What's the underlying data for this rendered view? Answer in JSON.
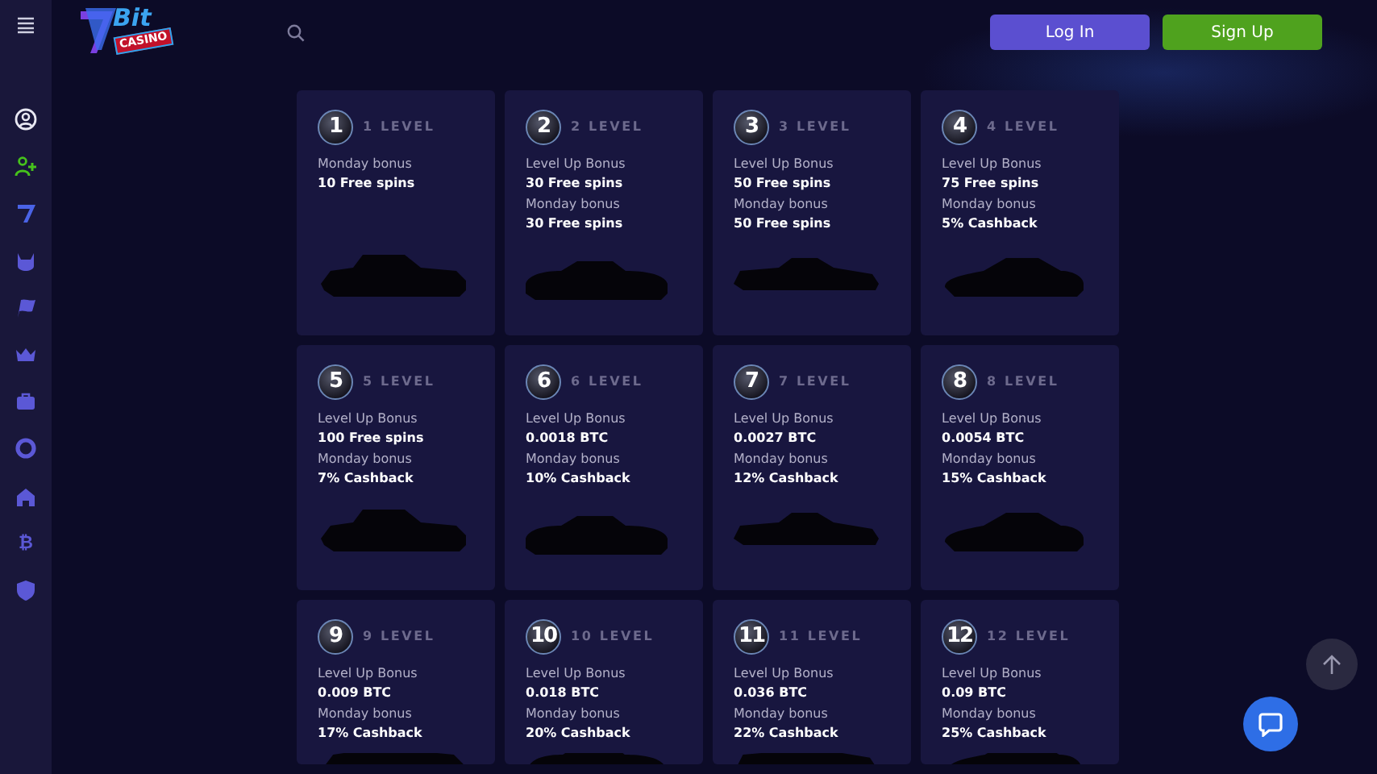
{
  "logo": {
    "word": "Bit",
    "sub": "CASINO"
  },
  "header": {
    "buttons": [
      {
        "label": "Log In",
        "kind": "login"
      },
      {
        "label": "Sign Up",
        "kind": "signup"
      }
    ]
  },
  "sidebar": {
    "items": [
      {
        "kind": "user"
      },
      {
        "kind": "user-plus"
      },
      {
        "kind": "seven"
      },
      {
        "kind": "shield-star"
      },
      {
        "kind": "flag"
      },
      {
        "kind": "crown"
      },
      {
        "kind": "briefcase"
      },
      {
        "kind": "lifebuoy"
      },
      {
        "kind": "house"
      },
      {
        "kind": "coin",
        "glyph": "₿"
      },
      {
        "kind": "shield"
      }
    ]
  },
  "levels": [
    {
      "number": "1",
      "title": "1 LEVEL",
      "lines": [
        {
          "text": "Monday bonus",
          "kind": "label"
        },
        {
          "text": "10 Free spins",
          "kind": "value"
        }
      ]
    },
    {
      "number": "2",
      "title": "2 LEVEL",
      "lines": [
        {
          "text": "Level Up Bonus",
          "kind": "label"
        },
        {
          "text": "30 Free spins",
          "kind": "value"
        },
        {
          "text": "Monday bonus",
          "kind": "label"
        },
        {
          "text": "30 Free spins",
          "kind": "value"
        }
      ]
    },
    {
      "number": "3",
      "title": "3 LEVEL",
      "lines": [
        {
          "text": "Level Up Bonus",
          "kind": "label"
        },
        {
          "text": "50 Free spins",
          "kind": "value"
        },
        {
          "text": "Monday bonus",
          "kind": "label"
        },
        {
          "text": "50 Free spins",
          "kind": "value"
        }
      ]
    },
    {
      "number": "4",
      "title": "4 LEVEL",
      "lines": [
        {
          "text": "Level Up Bonus",
          "kind": "label"
        },
        {
          "text": "75 Free spins",
          "kind": "value"
        },
        {
          "text": "Monday bonus",
          "kind": "label"
        },
        {
          "text": "5% Cashback",
          "kind": "value"
        }
      ]
    },
    {
      "number": "5",
      "title": "5 LEVEL",
      "lines": [
        {
          "text": "Level Up Bonus",
          "kind": "label"
        },
        {
          "text": "100 Free spins",
          "kind": "value"
        },
        {
          "text": "Monday bonus",
          "kind": "label"
        },
        {
          "text": "7% Cashback",
          "kind": "value"
        }
      ]
    },
    {
      "number": "6",
      "title": "6 LEVEL",
      "lines": [
        {
          "text": "Level Up Bonus",
          "kind": "label"
        },
        {
          "text": "0.0018 BTC",
          "kind": "value"
        },
        {
          "text": "Monday bonus",
          "kind": "label"
        },
        {
          "text": "10% Cashback",
          "kind": "value"
        }
      ]
    },
    {
      "number": "7",
      "title": "7 LEVEL",
      "lines": [
        {
          "text": "Level Up Bonus",
          "kind": "label"
        },
        {
          "text": "0.0027 BTC",
          "kind": "value"
        },
        {
          "text": "Monday bonus",
          "kind": "label"
        },
        {
          "text": "12% Cashback",
          "kind": "value"
        }
      ]
    },
    {
      "number": "8",
      "title": "8 LEVEL",
      "lines": [
        {
          "text": "Level Up Bonus",
          "kind": "label"
        },
        {
          "text": "0.0054 BTC",
          "kind": "value"
        },
        {
          "text": "Monday bonus",
          "kind": "label"
        },
        {
          "text": "15% Cashback",
          "kind": "value"
        }
      ]
    },
    {
      "number": "9",
      "title": "9 LEVEL",
      "lines": [
        {
          "text": "Level Up Bonus",
          "kind": "label"
        },
        {
          "text": "0.009 BTC",
          "kind": "value"
        },
        {
          "text": "Monday bonus",
          "kind": "label"
        },
        {
          "text": "17% Cashback",
          "kind": "value"
        }
      ]
    },
    {
      "number": "10",
      "title": "10 LEVEL",
      "lines": [
        {
          "text": "Level Up Bonus",
          "kind": "label"
        },
        {
          "text": "0.018 BTC",
          "kind": "value"
        },
        {
          "text": "Monday bonus",
          "kind": "label"
        },
        {
          "text": "20% Cashback",
          "kind": "value"
        }
      ]
    },
    {
      "number": "11",
      "title": "11 LEVEL",
      "lines": [
        {
          "text": "Level Up Bonus",
          "kind": "label"
        },
        {
          "text": "0.036 BTC",
          "kind": "value"
        },
        {
          "text": "Monday bonus",
          "kind": "label"
        },
        {
          "text": "22% Cashback",
          "kind": "value"
        }
      ]
    },
    {
      "number": "12",
      "title": "12 LEVEL",
      "lines": [
        {
          "text": "Level Up Bonus",
          "kind": "label"
        },
        {
          "text": "0.09 BTC",
          "kind": "value"
        },
        {
          "text": "Monday bonus",
          "kind": "label"
        },
        {
          "text": "25% Cashback",
          "kind": "value"
        }
      ]
    }
  ]
}
